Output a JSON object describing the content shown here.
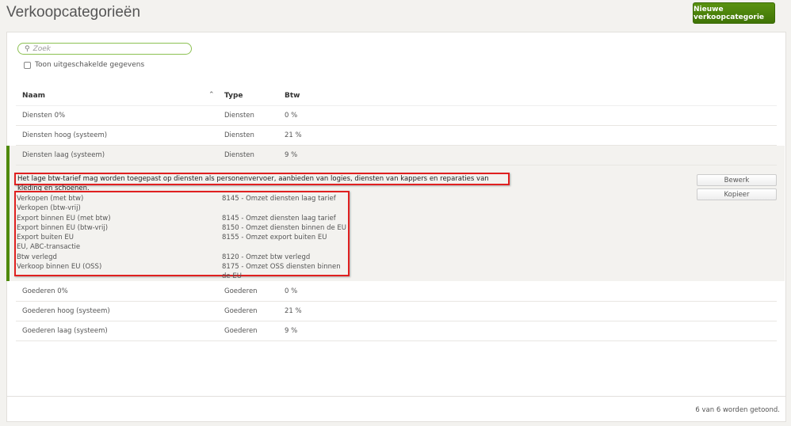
{
  "header": {
    "title": "Verkoopcategorieën",
    "new_button": "Nieuwe verkoopcategorie"
  },
  "search": {
    "placeholder": "Zoek",
    "show_disabled_label": "Toon uitgeschakelde gegevens"
  },
  "table": {
    "columns": [
      "Naam",
      "Type",
      "Btw"
    ],
    "rows_top": [
      {
        "name": "Diensten 0%",
        "type": "Diensten",
        "btw": "0 %"
      },
      {
        "name": "Diensten hoog (systeem)",
        "type": "Diensten",
        "btw": "21 %"
      },
      {
        "name": "Diensten laag (systeem)",
        "type": "Diensten",
        "btw": "9 %"
      }
    ],
    "rows_bottom": [
      {
        "name": "Goederen 0%",
        "type": "Goederen",
        "btw": "0 %"
      },
      {
        "name": "Goederen hoog (systeem)",
        "type": "Goederen",
        "btw": "21 %"
      },
      {
        "name": "Goederen laag (systeem)",
        "type": "Goederen",
        "btw": "9 %"
      }
    ]
  },
  "detail": {
    "description": "Het lage btw-tarief mag worden toegepast op diensten als personenvervoer, aanbieden van logies, diensten van kappers en reparaties van kleding en schoenen.",
    "accounts": [
      {
        "label": "Verkopen (met btw)",
        "account": "8145 - Omzet diensten laag tarief"
      },
      {
        "label": "Verkopen (btw-vrij)",
        "account": ""
      },
      {
        "label": "Export binnen EU (met btw)",
        "account": "8145 - Omzet diensten laag tarief"
      },
      {
        "label": "Export binnen EU (btw-vrij)",
        "account": "8150 - Omzet diensten binnen de EU"
      },
      {
        "label": "Export buiten EU",
        "account": "8155 - Omzet export buiten EU"
      },
      {
        "label": "EU, ABC-transactie",
        "account": ""
      },
      {
        "label": "Btw verlegd",
        "account": "8120 - Omzet btw verlegd"
      },
      {
        "label": "Verkoop binnen EU (OSS)",
        "account": "8175 - Omzet OSS diensten binnen de EU"
      }
    ],
    "edit_button": "Bewerk",
    "copy_button": "Kopieer"
  },
  "footer": {
    "count": "6 van 6 worden getoond."
  },
  "colors": {
    "accent": "#4f8a0b",
    "highlight": "#e02020"
  }
}
